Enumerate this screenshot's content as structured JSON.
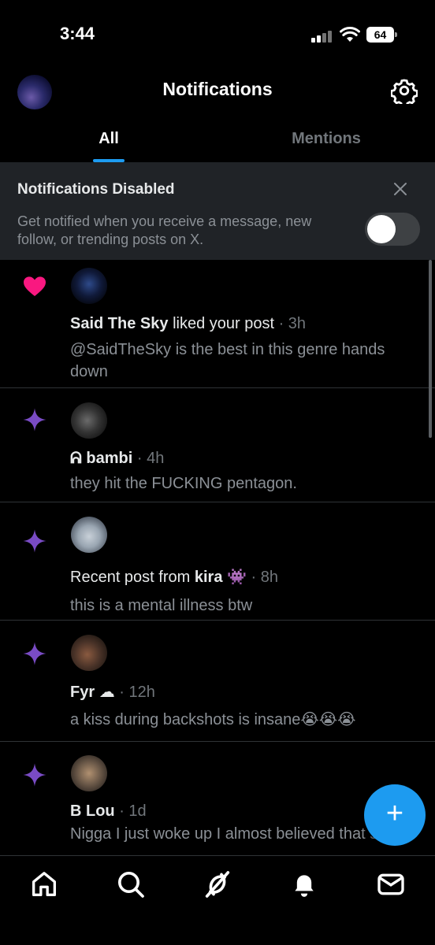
{
  "status_bar": {
    "time": "3:44",
    "battery": "64"
  },
  "header": {
    "title": "Notifications"
  },
  "tabs": [
    {
      "label": "All"
    },
    {
      "label": "Mentions"
    }
  ],
  "banner": {
    "title": "Notifications Disabled",
    "description": "Get notified when you receive a message, new follow, or trending posts on X."
  },
  "notifications": [
    {
      "type": "like",
      "user": "Said The Sky",
      "action": "liked your post",
      "time": "· 3h",
      "text": "@SaidTheSky is the best in this genre hands down"
    },
    {
      "type": "recent",
      "user": "ᕱ bambi",
      "time": "· 4h",
      "text": "they hit the FUCKING pentagon."
    },
    {
      "type": "recent",
      "prefix": "Recent post from",
      "user": "kira",
      "emoji": "👾",
      "time": "· 8h",
      "text": "this is a mental illness btw"
    },
    {
      "type": "recent",
      "user": "Fyr",
      "emoji": "☁",
      "time": "· 12h",
      "text": "a kiss during backshots is insane😭😭😭"
    },
    {
      "type": "recent",
      "user": "B Lou",
      "time": "· 1d",
      "text": "Nigga I just woke up I almost believed that shit 😂"
    }
  ],
  "icons": {
    "like": "heart-icon",
    "recent": "sparkle-icon",
    "settings": "gear-icon",
    "close": "close-icon",
    "compose": "plus-icon",
    "nav": [
      "home-icon",
      "search-icon",
      "grok-icon",
      "bell-icon",
      "mail-icon"
    ]
  },
  "colors": {
    "accent": "#1d9bf0",
    "like": "#f91880",
    "sparkle": "#794bc4",
    "banner_bg": "#202327"
  }
}
